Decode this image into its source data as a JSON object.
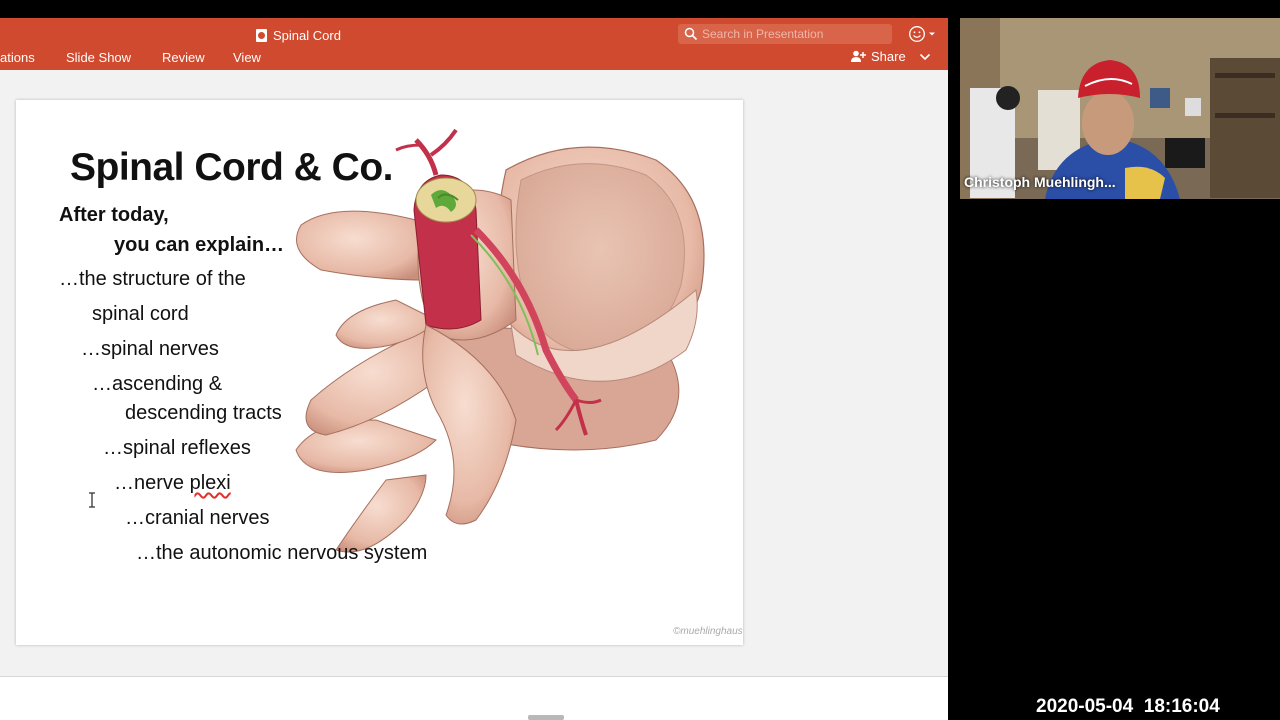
{
  "window": {
    "title": "Spinal Cord"
  },
  "ribbon": {
    "tabs": [
      {
        "label": "ations"
      },
      {
        "label": "Slide Show"
      },
      {
        "label": "Review"
      },
      {
        "label": "View"
      }
    ],
    "share_label": "Share"
  },
  "search": {
    "placeholder": "Search in Presentation"
  },
  "slide": {
    "title": "Spinal Cord & Co.",
    "intro_line1": "After today,",
    "intro_line2": "you can explain…",
    "objectives": [
      "…the structure of the",
      "spinal cord",
      "…spinal nerves",
      "…ascending &",
      "descending tracts",
      "…spinal reflexes",
      "…nerve ",
      "plexi",
      "…cranial nerves",
      "…the autonomic nervous system"
    ],
    "copyright": "©muehlinghaus",
    "illustration_icon": "vertebra-spinal-cord-illustration"
  },
  "video": {
    "participant_name": "Christoph Muehlingh..."
  },
  "recording": {
    "timestamp": "2020-05-04  18:16:04"
  },
  "colors": {
    "ribbon": "#cf4a2e",
    "slide_bg": "#ffffff",
    "app_bg": "#f2f2f2"
  }
}
